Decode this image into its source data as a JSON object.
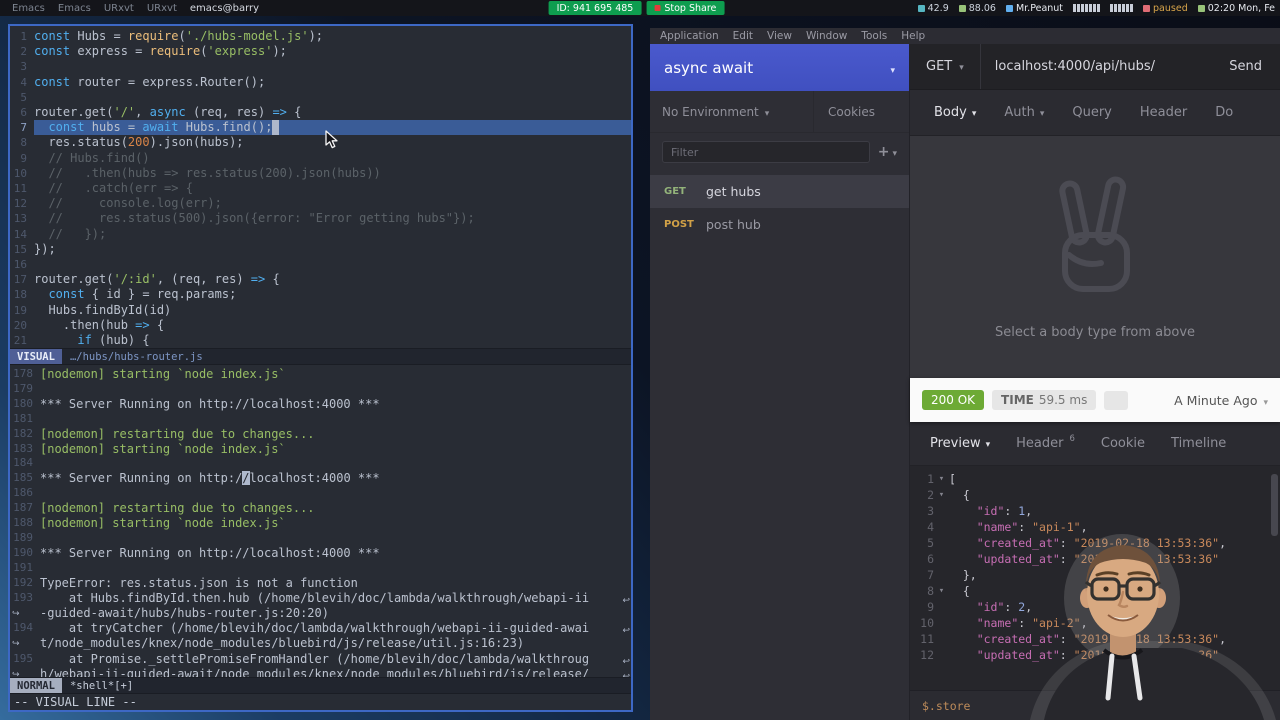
{
  "topbar": {
    "windows": [
      "Emacs",
      "Emacs",
      "URxvt",
      "URxvt",
      "emacs@barry"
    ],
    "zoom_id": "ID: 941 695 485",
    "stop_share": "Stop Share",
    "tray": [
      {
        "icon": "#56b6c2",
        "label": "42.9",
        "color": "#cdd3dd"
      },
      {
        "icon": "#98c379",
        "label": "88.06",
        "color": "#cdd3dd"
      },
      {
        "icon": "#61afef",
        "label": "Mr.Peanut",
        "color": "#e6e9ef"
      },
      {
        "bars": 7
      },
      {
        "bars": 6
      },
      {
        "icon": "#e06c75",
        "label": "paused",
        "color": "#d7a44a"
      },
      {
        "icon": "#98c379",
        "label": "02:20 Mon, Fe",
        "color": "#e6e9ef"
      }
    ]
  },
  "editor": {
    "lines": [
      "const Hubs = require('./hubs-model.js');",
      "const express = require('express');",
      "",
      "const router = express.Router();",
      "",
      "router.get('/', async (req, res) => {",
      "  const hubs = await Hubs.find();",
      "  res.status(200).json(hubs);",
      "  // Hubs.find()",
      "  //   .then(hubs => res.status(200).json(hubs))",
      "  //   .catch(err => {",
      "  //     console.log(err);",
      "  //     res.status(500).json({error: \"Error getting hubs\"});",
      "  //   });",
      "});",
      "",
      "router.get('/:id', (req, res) => {",
      "  const { id } = req.params;",
      "  Hubs.findById(id)",
      "    .then(hub => {",
      "      if (hub) {"
    ],
    "selected_line": 7,
    "modeline": {
      "mode": "VISUAL",
      "path": "…/hubs/hubs-router.js"
    }
  },
  "shell": {
    "lines": [
      {
        "n": 178,
        "t": "[nodemon] starting `node index.js`"
      },
      {
        "n": 179,
        "t": ""
      },
      {
        "n": 180,
        "t": "*** Server Running on http://localhost:4000 ***"
      },
      {
        "n": 181,
        "t": ""
      },
      {
        "n": 182,
        "t": "[nodemon] restarting due to changes..."
      },
      {
        "n": 183,
        "t": "[nodemon] starting `node index.js`"
      },
      {
        "n": 184,
        "t": ""
      },
      {
        "n": 185,
        "t": "*** Server Running on http://localhost:4000 ***"
      },
      {
        "n": 186,
        "t": ""
      },
      {
        "n": 187,
        "t": "[nodemon] restarting due to changes..."
      },
      {
        "n": 188,
        "t": "[nodemon] starting `node index.js`"
      },
      {
        "n": 189,
        "t": ""
      },
      {
        "n": 190,
        "t": "*** Server Running on http://localhost:4000 ***"
      },
      {
        "n": 191,
        "t": ""
      },
      {
        "n": 192,
        "t": "TypeError: res.status.json is not a function"
      },
      {
        "n": 193,
        "t": "    at Hubs.findById.then.hub (/home/blevih/doc/lambda/walkthrough/webapi-ii",
        "wrap": true
      },
      {
        "t": "-guided-await/hubs/hubs-router.js:20:20)",
        "cont": true
      },
      {
        "n": 194,
        "t": "    at tryCatcher (/home/blevih/doc/lambda/walkthrough/webapi-ii-guided-awai",
        "wrap": true
      },
      {
        "t": "t/node_modules/knex/node_modules/bluebird/js/release/util.js:16:23)",
        "cont": true
      },
      {
        "n": 195,
        "t": "    at Promise._settlePromiseFromHandler (/home/blevih/doc/lambda/walkthroug",
        "wrap": true
      },
      {
        "t": "h/webapi-ii-guided-await/node_modules/knex/node_modules/bluebird/js/release/",
        "cont": true,
        "wrap": true
      }
    ],
    "cursor_line": 185,
    "cursor_prefix": "*** Server Running on http:/",
    "modeline": {
      "mode": "NORMAL",
      "buffer": "*shell*[+]"
    },
    "echo": "-- VISUAL LINE --"
  },
  "insomnia": {
    "menu": [
      "Application",
      "Edit",
      "View",
      "Window",
      "Tools",
      "Help"
    ],
    "sidebar": {
      "workspace": "async await",
      "environment": "No Environment",
      "cookies": "Cookies",
      "filter_placeholder": "Filter",
      "requests": [
        {
          "method": "GET",
          "name": "get hubs",
          "selected": true
        },
        {
          "method": "POST",
          "name": "post hub",
          "selected": false
        }
      ]
    },
    "url_bar": {
      "method": "GET",
      "url": "localhost:4000/api/hubs/",
      "send": "Send"
    },
    "request_tabs": [
      {
        "label": "Body",
        "caret": true,
        "active": true
      },
      {
        "label": "Auth",
        "caret": true
      },
      {
        "label": "Query"
      },
      {
        "label": "Header"
      },
      {
        "label": "Do"
      }
    ],
    "body_hint": "Select a body type from above",
    "response": {
      "status": "200 OK",
      "time_label": "TIME",
      "time_value": "59.5 ms",
      "history": "A Minute Ago",
      "tabs": [
        {
          "label": "Preview",
          "caret": true,
          "active": true
        },
        {
          "label": "Header",
          "badge": "6"
        },
        {
          "label": "Cookie"
        },
        {
          "label": "Timeline"
        }
      ],
      "json_lines": [
        {
          "num": 1,
          "fold": true,
          "text": "["
        },
        {
          "num": 2,
          "fold": true,
          "text": "  {"
        },
        {
          "num": 3,
          "text": "    \"id\": 1,"
        },
        {
          "num": 4,
          "text": "    \"name\": \"api-1\","
        },
        {
          "num": 5,
          "text": "    \"created_at\": \"2019-02-18 13:53:36\","
        },
        {
          "num": 6,
          "text": "    \"updated_at\": \"2019-02-18 13:53:36\""
        },
        {
          "num": 7,
          "text": "  },"
        },
        {
          "num": 8,
          "fold": true,
          "text": "  {"
        },
        {
          "num": 9,
          "text": "    \"id\": 2,"
        },
        {
          "num": 10,
          "text": "    \"name\": \"api-2\","
        },
        {
          "num": 11,
          "text": "    \"created_at\": \"2019-02-18 13:53:36\","
        },
        {
          "num": 12,
          "text": "    \"updated_at\": \"2019-02-18 13:53:36\""
        }
      ],
      "path_filter": "$.store",
      "help": "?"
    }
  }
}
